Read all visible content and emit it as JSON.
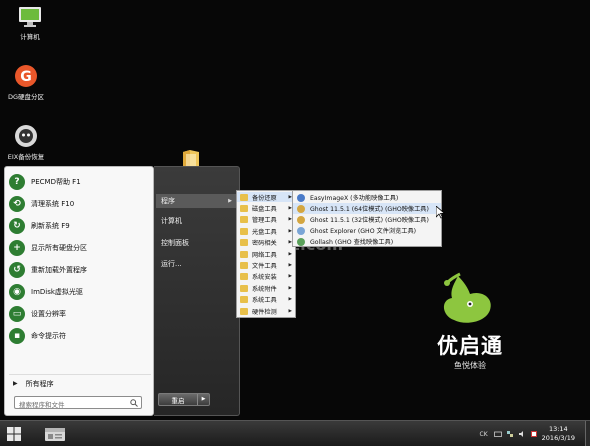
{
  "desktop": {
    "icons": [
      {
        "label": "计算机",
        "icon": "computer-icon"
      },
      {
        "label": "DG硬盘分区",
        "icon": "diskgenius-icon"
      },
      {
        "label": "EIX备份恢复",
        "icon": "eix-backup-icon"
      }
    ]
  },
  "start_menu": {
    "programs": [
      {
        "label": "PECMD帮助 F1",
        "icon": "help-icon",
        "color": "#2e7d32"
      },
      {
        "label": "清理系统 F10",
        "icon": "clean-icon",
        "color": "#2e7d32"
      },
      {
        "label": "刷新系统 F9",
        "icon": "refresh-icon",
        "color": "#2e7d32"
      },
      {
        "label": "显示所有硬盘分区",
        "icon": "add-icon",
        "color": "#2e7d32"
      },
      {
        "label": "重新加载外置程序",
        "icon": "reload-icon",
        "color": "#2e7d32"
      },
      {
        "label": "ImDisk虚拟光驱",
        "icon": "disc-icon",
        "color": "#2e7d32"
      },
      {
        "label": "设置分辨率",
        "icon": "monitor-icon",
        "color": "#2e7d32"
      },
      {
        "label": "命令提示符",
        "icon": "terminal-icon",
        "color": "#2e7d32"
      }
    ],
    "all_programs_label": "所有程序",
    "search_placeholder": "搜索程序和文件",
    "right_items": [
      {
        "label": "程序",
        "has_submenu": true
      },
      {
        "label": "计算机",
        "has_submenu": false
      },
      {
        "label": "控制面板",
        "has_submenu": false
      },
      {
        "label": "运行...",
        "has_submenu": false
      }
    ],
    "shutdown_label": "重启"
  },
  "programs_submenu": {
    "items": [
      "备份还原",
      "磁盘工具",
      "管理工具",
      "光盘工具",
      "密码相关",
      "网络工具",
      "文件工具",
      "系统安装",
      "系统附件",
      "系统工具",
      "硬件检测"
    ]
  },
  "backup_submenu": {
    "items": [
      {
        "label": "EasyImageX (多功能映像工具)",
        "icon": "easyimagex-icon",
        "color": "#4a7bc8"
      },
      {
        "label": "Ghost 11.5.1 (64位模式) (GHO映像工具)",
        "icon": "ghost-icon",
        "color": "#d4a640"
      },
      {
        "label": "Ghost 11.5.1 (32位模式) (GHO映像工具)",
        "icon": "ghost-icon",
        "color": "#d4a640"
      },
      {
        "label": "Ghost Explorer (GHO 文件浏览工具)",
        "icon": "ghost-explorer-icon",
        "color": "#7aa5d6"
      },
      {
        "label": "Gollash (GHO 查找映像工具)",
        "icon": "gollash-icon",
        "color": "#5aa05a"
      }
    ]
  },
  "watermark": {
    "text": "anxz.com"
  },
  "brand": {
    "name": "优启通",
    "subtitle": "鱼悦体验",
    "accent": "#8dc63f"
  },
  "taskbar": {
    "lang": "CK",
    "time": "13:14",
    "date": "2016/3/19"
  }
}
